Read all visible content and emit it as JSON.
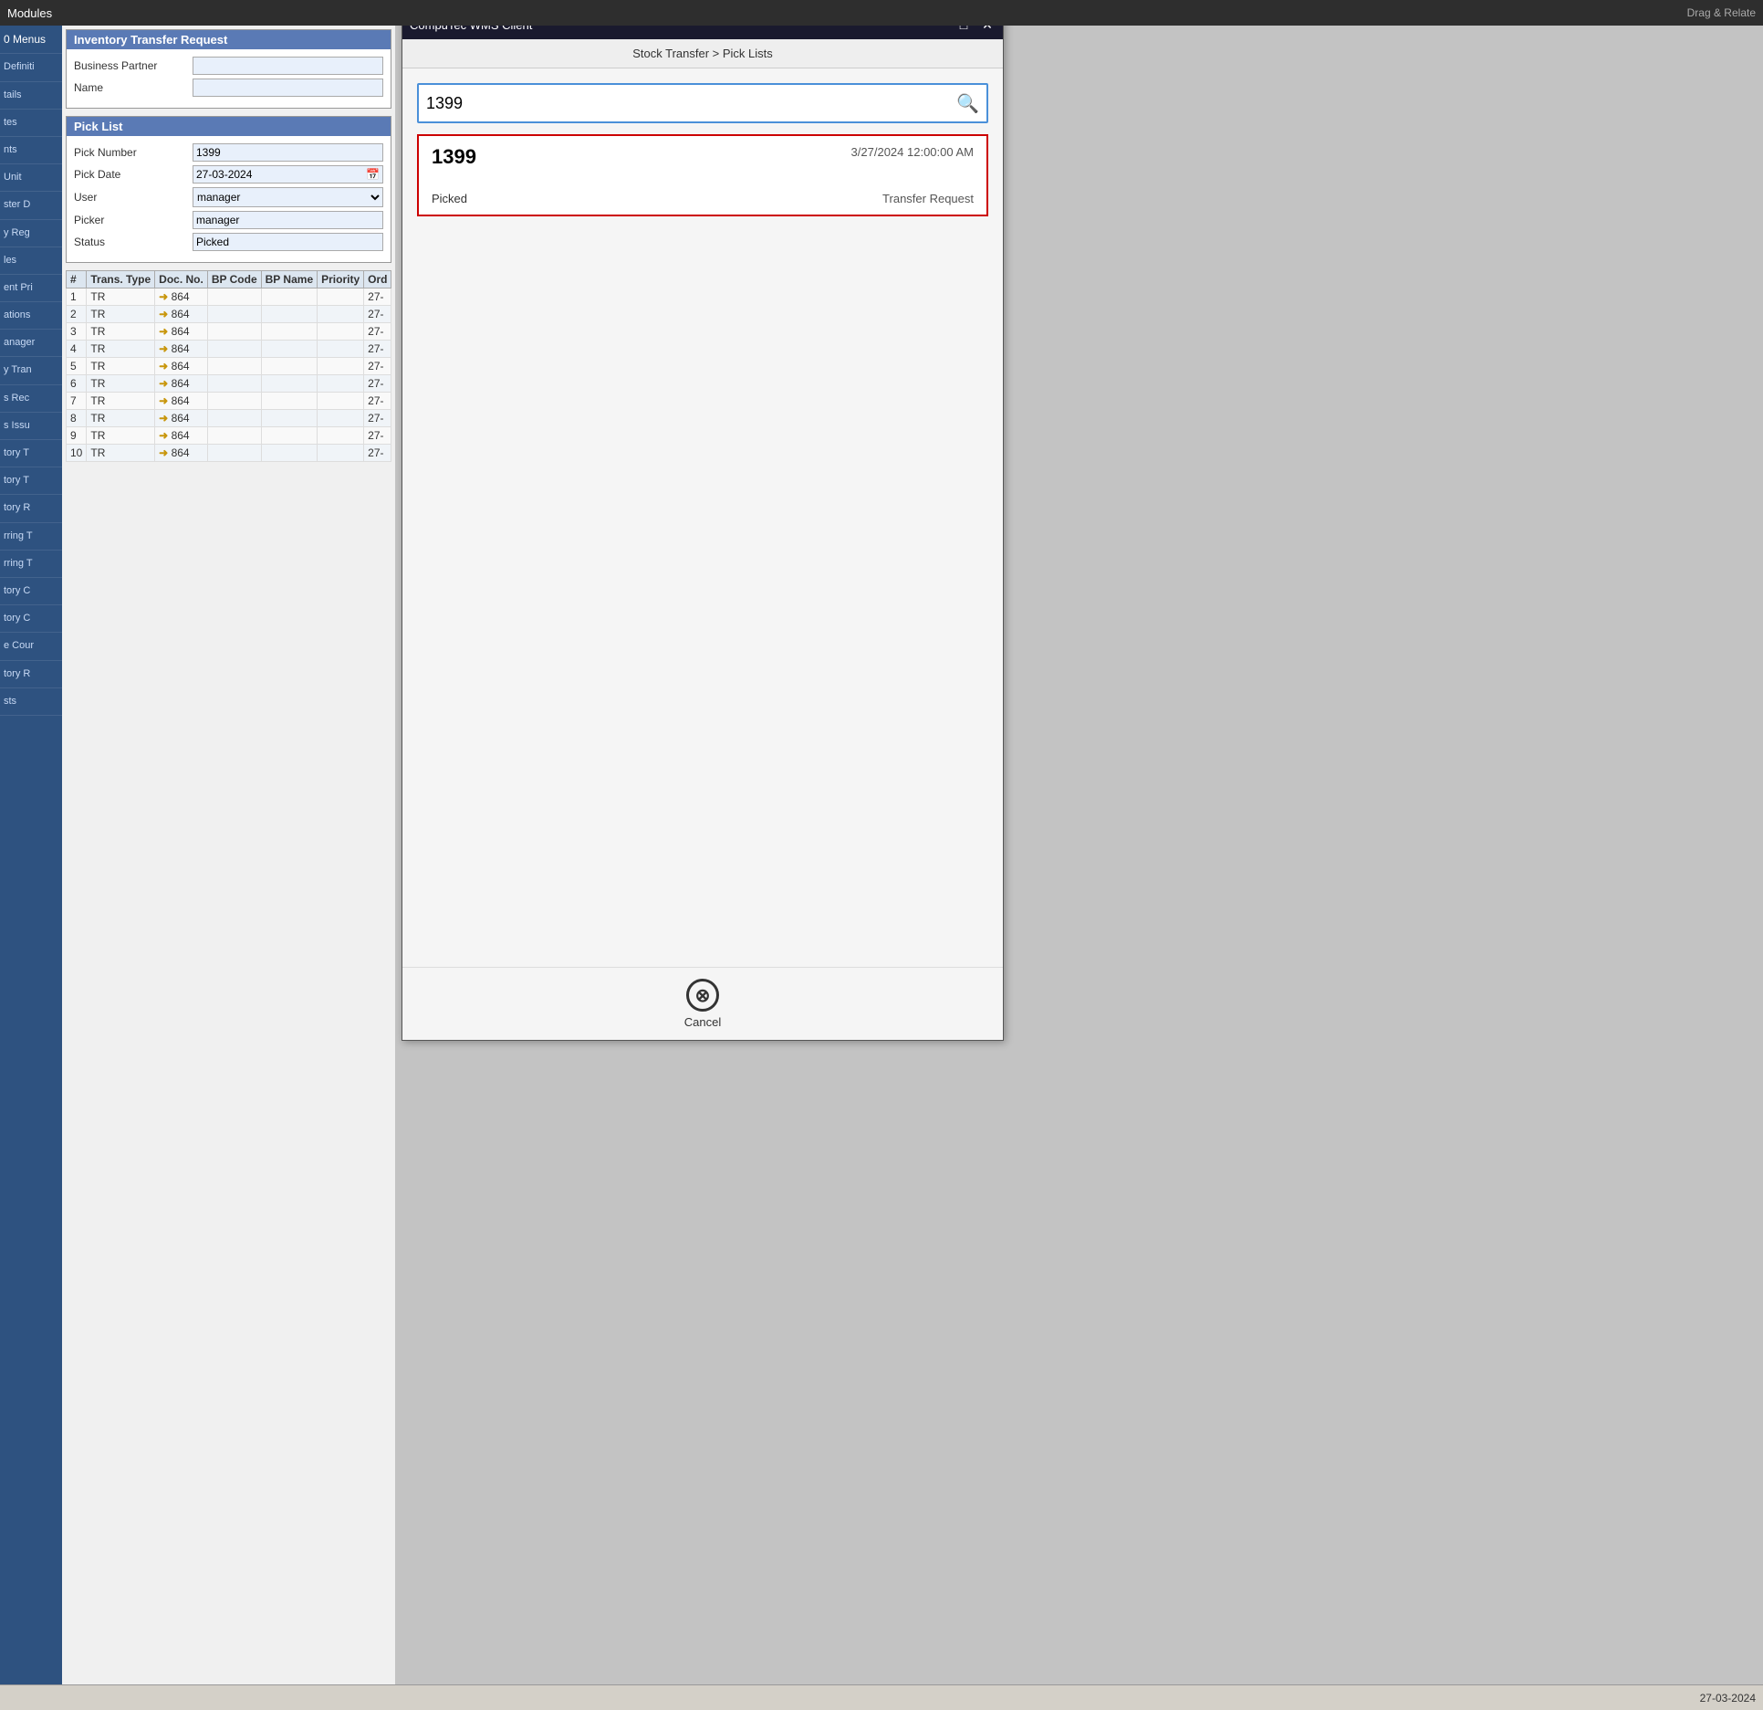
{
  "topbar": {
    "modules_label": "Modules",
    "drag_relate_label": "Drag & Relate"
  },
  "menus_label": "0 Menus",
  "sidebar": {
    "items": [
      {
        "label": "Definiti"
      },
      {
        "label": "tails"
      },
      {
        "label": "tes"
      },
      {
        "label": "nts"
      },
      {
        "label": "Unit"
      },
      {
        "label": "ster D"
      },
      {
        "label": "y Reg"
      },
      {
        "label": "les"
      },
      {
        "label": "ent Pri"
      },
      {
        "label": "ations"
      },
      {
        "label": "anager"
      },
      {
        "label": "y Tran"
      },
      {
        "label": "s Rec"
      },
      {
        "label": "s Issu"
      },
      {
        "label": "tory T"
      },
      {
        "label": "tory T"
      },
      {
        "label": "tory R"
      },
      {
        "label": "rring T"
      },
      {
        "label": "rring T"
      },
      {
        "label": "tory C"
      },
      {
        "label": "tory C"
      },
      {
        "label": "e Cour"
      },
      {
        "label": "tory R"
      },
      {
        "label": "sts"
      }
    ]
  },
  "itr_form": {
    "title": "Inventory Transfer Request",
    "business_partner_label": "Business Partner",
    "name_label": "Name",
    "business_partner_value": "",
    "name_value": ""
  },
  "pick_list": {
    "title": "Pick List",
    "pick_number_label": "Pick Number",
    "pick_number_value": "1399",
    "pick_date_label": "Pick Date",
    "pick_date_value": "27-03-2024",
    "user_label": "User",
    "user_value": "manager",
    "picker_label": "Picker",
    "picker_value": "manager",
    "status_label": "Status",
    "status_value": "Picked",
    "table": {
      "columns": [
        "#",
        "Trans. Type",
        "Doc. No.",
        "BP Code",
        "BP Name",
        "Priority",
        "Ord"
      ],
      "rows": [
        {
          "num": "1",
          "trans_type": "TR",
          "doc_no": "864",
          "bp_code": "",
          "bp_name": "",
          "priority": "",
          "ord": "27-"
        },
        {
          "num": "2",
          "trans_type": "TR",
          "doc_no": "864",
          "bp_code": "",
          "bp_name": "",
          "priority": "",
          "ord": "27-"
        },
        {
          "num": "3",
          "trans_type": "TR",
          "doc_no": "864",
          "bp_code": "",
          "bp_name": "",
          "priority": "",
          "ord": "27-"
        },
        {
          "num": "4",
          "trans_type": "TR",
          "doc_no": "864",
          "bp_code": "",
          "bp_name": "",
          "priority": "",
          "ord": "27-"
        },
        {
          "num": "5",
          "trans_type": "TR",
          "doc_no": "864",
          "bp_code": "",
          "bp_name": "",
          "priority": "",
          "ord": "27-"
        },
        {
          "num": "6",
          "trans_type": "TR",
          "doc_no": "864",
          "bp_code": "",
          "bp_name": "",
          "priority": "",
          "ord": "27-"
        },
        {
          "num": "7",
          "trans_type": "TR",
          "doc_no": "864",
          "bp_code": "",
          "bp_name": "",
          "priority": "",
          "ord": "27-"
        },
        {
          "num": "8",
          "trans_type": "TR",
          "doc_no": "864",
          "bp_code": "",
          "bp_name": "",
          "priority": "",
          "ord": "27-"
        },
        {
          "num": "9",
          "trans_type": "TR",
          "doc_no": "864",
          "bp_code": "",
          "bp_name": "",
          "priority": "",
          "ord": "27-"
        },
        {
          "num": "10",
          "trans_type": "TR",
          "doc_no": "864",
          "bp_code": "",
          "bp_name": "",
          "priority": "",
          "ord": "27-"
        }
      ]
    }
  },
  "wms": {
    "title": "CompuTec WMS Client",
    "breadcrumb": "Stock Transfer > Pick Lists",
    "search": {
      "value": "1399",
      "placeholder": ""
    },
    "result": {
      "number": "1399",
      "date": "3/27/2024 12:00:00 AM",
      "status": "Picked",
      "type": "Transfer Request"
    },
    "cancel_label": "Cancel"
  },
  "bottom_bar": {
    "date": "27-03-2024"
  },
  "colors": {
    "sap_topbar": "#2e2e2e",
    "sap_nav": "#2e5280",
    "sap_header": "#5a7ab5",
    "wms_titlebar": "#1a1a2e",
    "wms_border": "#cc0000",
    "search_border": "#4a90d9",
    "arrow": "#c8960c"
  }
}
